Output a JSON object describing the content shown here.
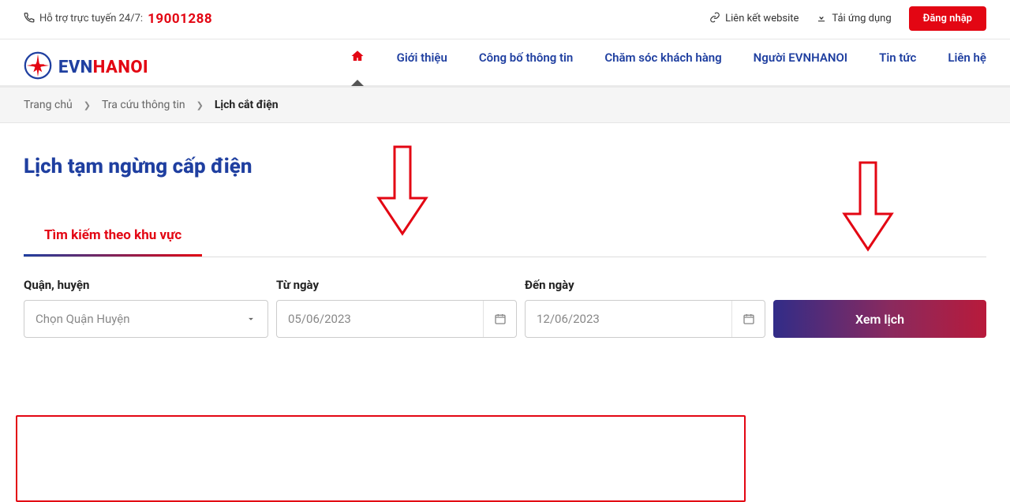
{
  "topbar": {
    "support_label": "Hỗ trợ trực tuyến 24/7:",
    "hotline": "19001288",
    "link_website": "Liên kết website",
    "download_app": "Tải ứng dụng",
    "login": "Đăng nhập"
  },
  "logo": {
    "evn": "EVN",
    "hanoi": "HANOI"
  },
  "nav": {
    "items": [
      {
        "label": ""
      },
      {
        "label": "Giới thiệu"
      },
      {
        "label": "Công bố thông tin"
      },
      {
        "label": "Chăm sóc khách hàng"
      },
      {
        "label": "Người EVNHANOI"
      },
      {
        "label": "Tin tức"
      },
      {
        "label": "Liên hệ"
      }
    ]
  },
  "breadcrumb": {
    "items": [
      {
        "label": "Trang chủ"
      },
      {
        "label": "Tra cứu thông tin"
      },
      {
        "label": "Lịch cắt điện"
      }
    ]
  },
  "page": {
    "title": "Lịch tạm ngừng cấp điện",
    "tab_label": "Tìm kiếm theo khu vực",
    "form": {
      "district_label": "Quận, huyện",
      "district_placeholder": "Chọn Quận Huyện",
      "from_label": "Từ ngày",
      "from_value": "05/06/2023",
      "to_label": "Đến ngày",
      "to_value": "12/06/2023",
      "submit": "Xem lịch"
    }
  },
  "colors": {
    "brand_blue": "#1f3fa0",
    "brand_red": "#E30613"
  }
}
